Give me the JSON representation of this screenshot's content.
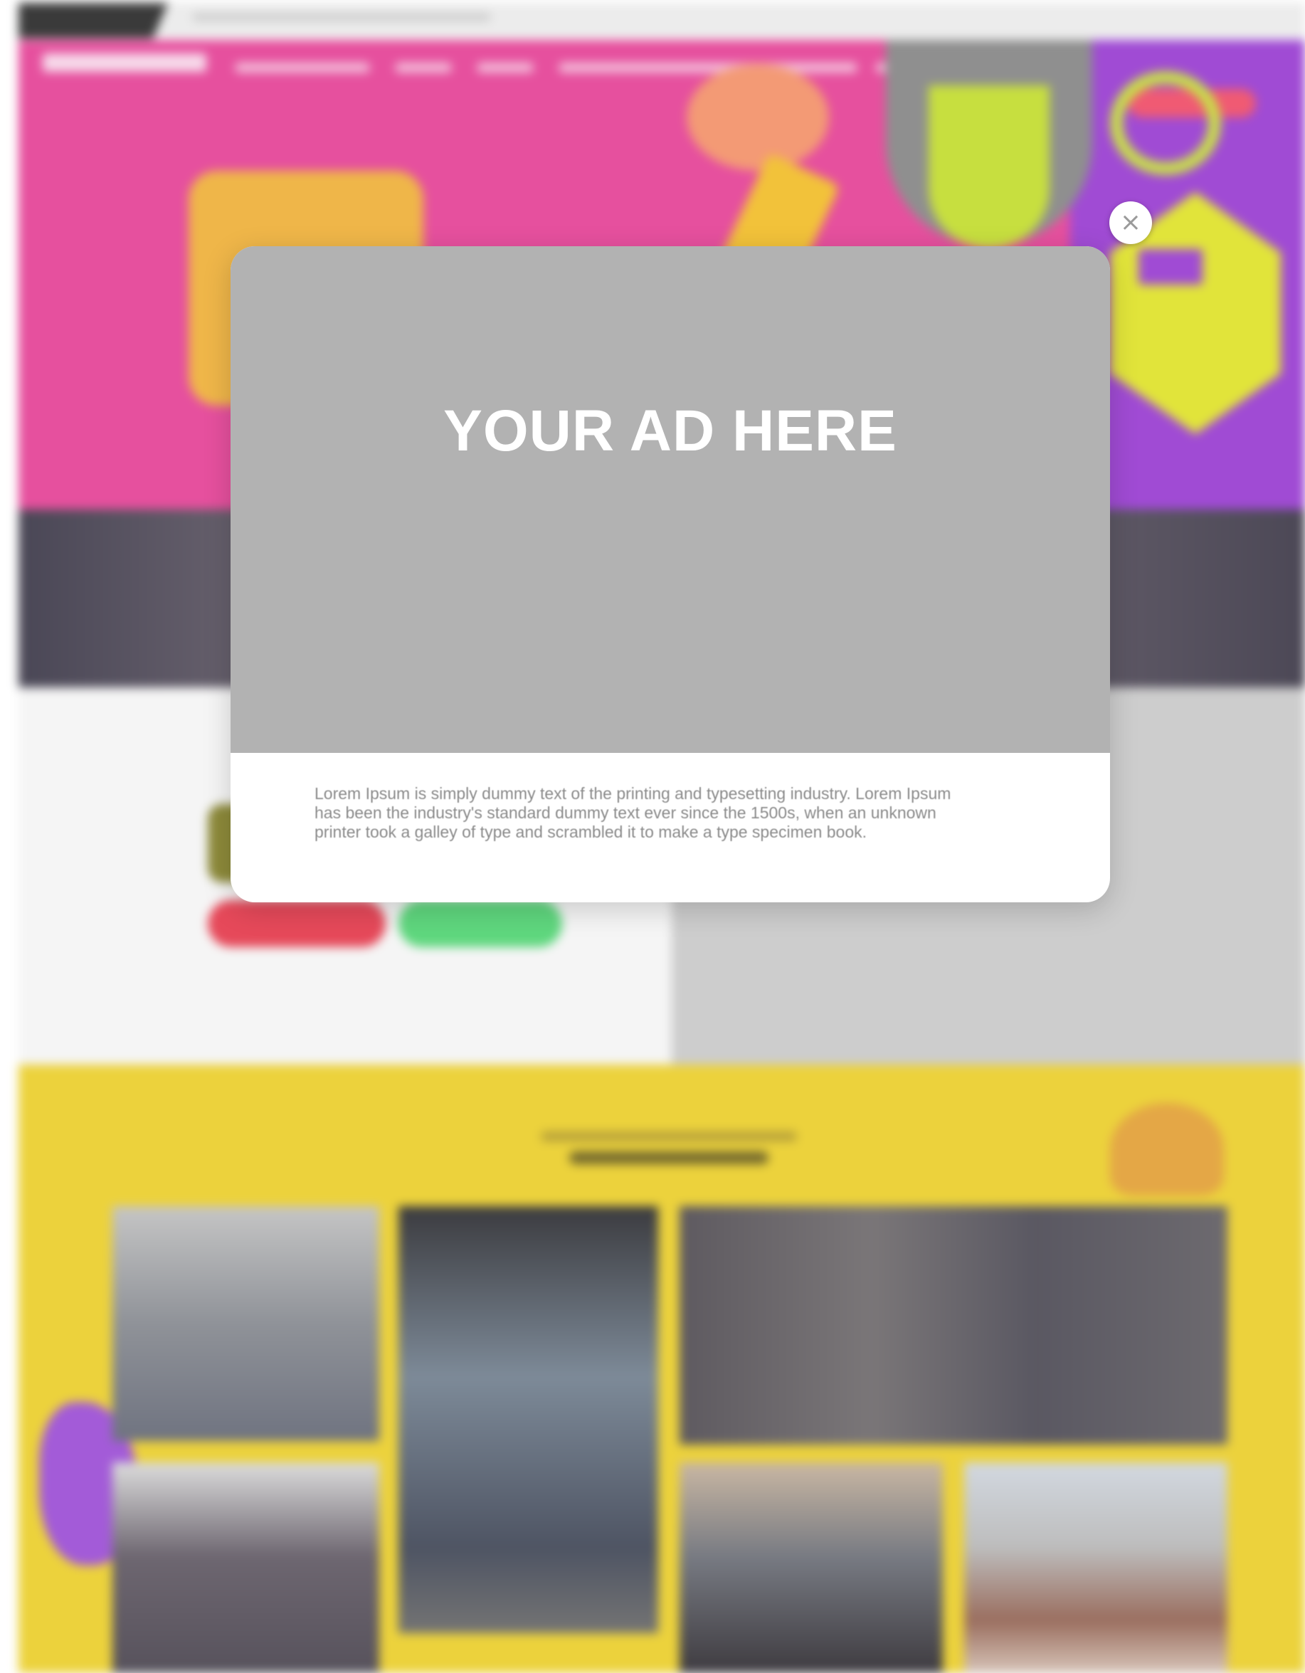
{
  "modal": {
    "ad_heading": "YOUR AD HERE",
    "body_text": "Lorem Ipsum is simply dummy text of the printing and typesetting industry. Lorem Ipsum has been the industry's standard dummy text ever since the 1500s, when an unknown printer took a galley of type and scrambled it to make a type specimen book.",
    "close_icon": "×"
  },
  "colors": {
    "hero_pink": "#e6509e",
    "hero_purple": "#a04bd4",
    "gallery_yellow": "#ecd23c",
    "ad_gray": "#b2b2b2",
    "button_red": "#e6495a",
    "button_green": "#5fd77e"
  },
  "icons": {
    "close": "close-icon"
  }
}
